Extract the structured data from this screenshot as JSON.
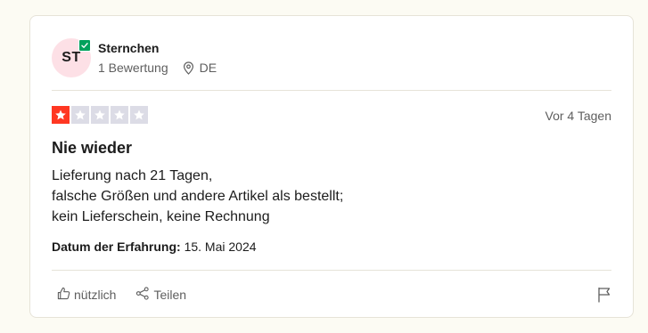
{
  "review": {
    "user": {
      "initials": "ST",
      "name": "Sternchen",
      "review_count": "1 Bewertung",
      "country": "DE",
      "avatar_color": "#fde0e6",
      "verified_color": "#00a15c"
    },
    "rating": {
      "stars": 1,
      "max_stars": 5,
      "filled_color": "#ff3722",
      "empty_color": "#dcdce6"
    },
    "date": "Vor 4 Tagen",
    "title": "Nie wieder",
    "body_lines": [
      "Lieferung nach 21 Tagen,",
      "falsche Größen und andere Artikel als bestellt;",
      "kein Lieferschein, keine Rechnung"
    ],
    "experience_label": "Datum der Erfahrung:",
    "experience_date": "15. Mai 2024"
  },
  "actions": {
    "useful_label": "nützlich",
    "share_label": "Teilen",
    "icons": [
      "thumbs-up-icon",
      "share-icon",
      "flag-icon"
    ]
  }
}
